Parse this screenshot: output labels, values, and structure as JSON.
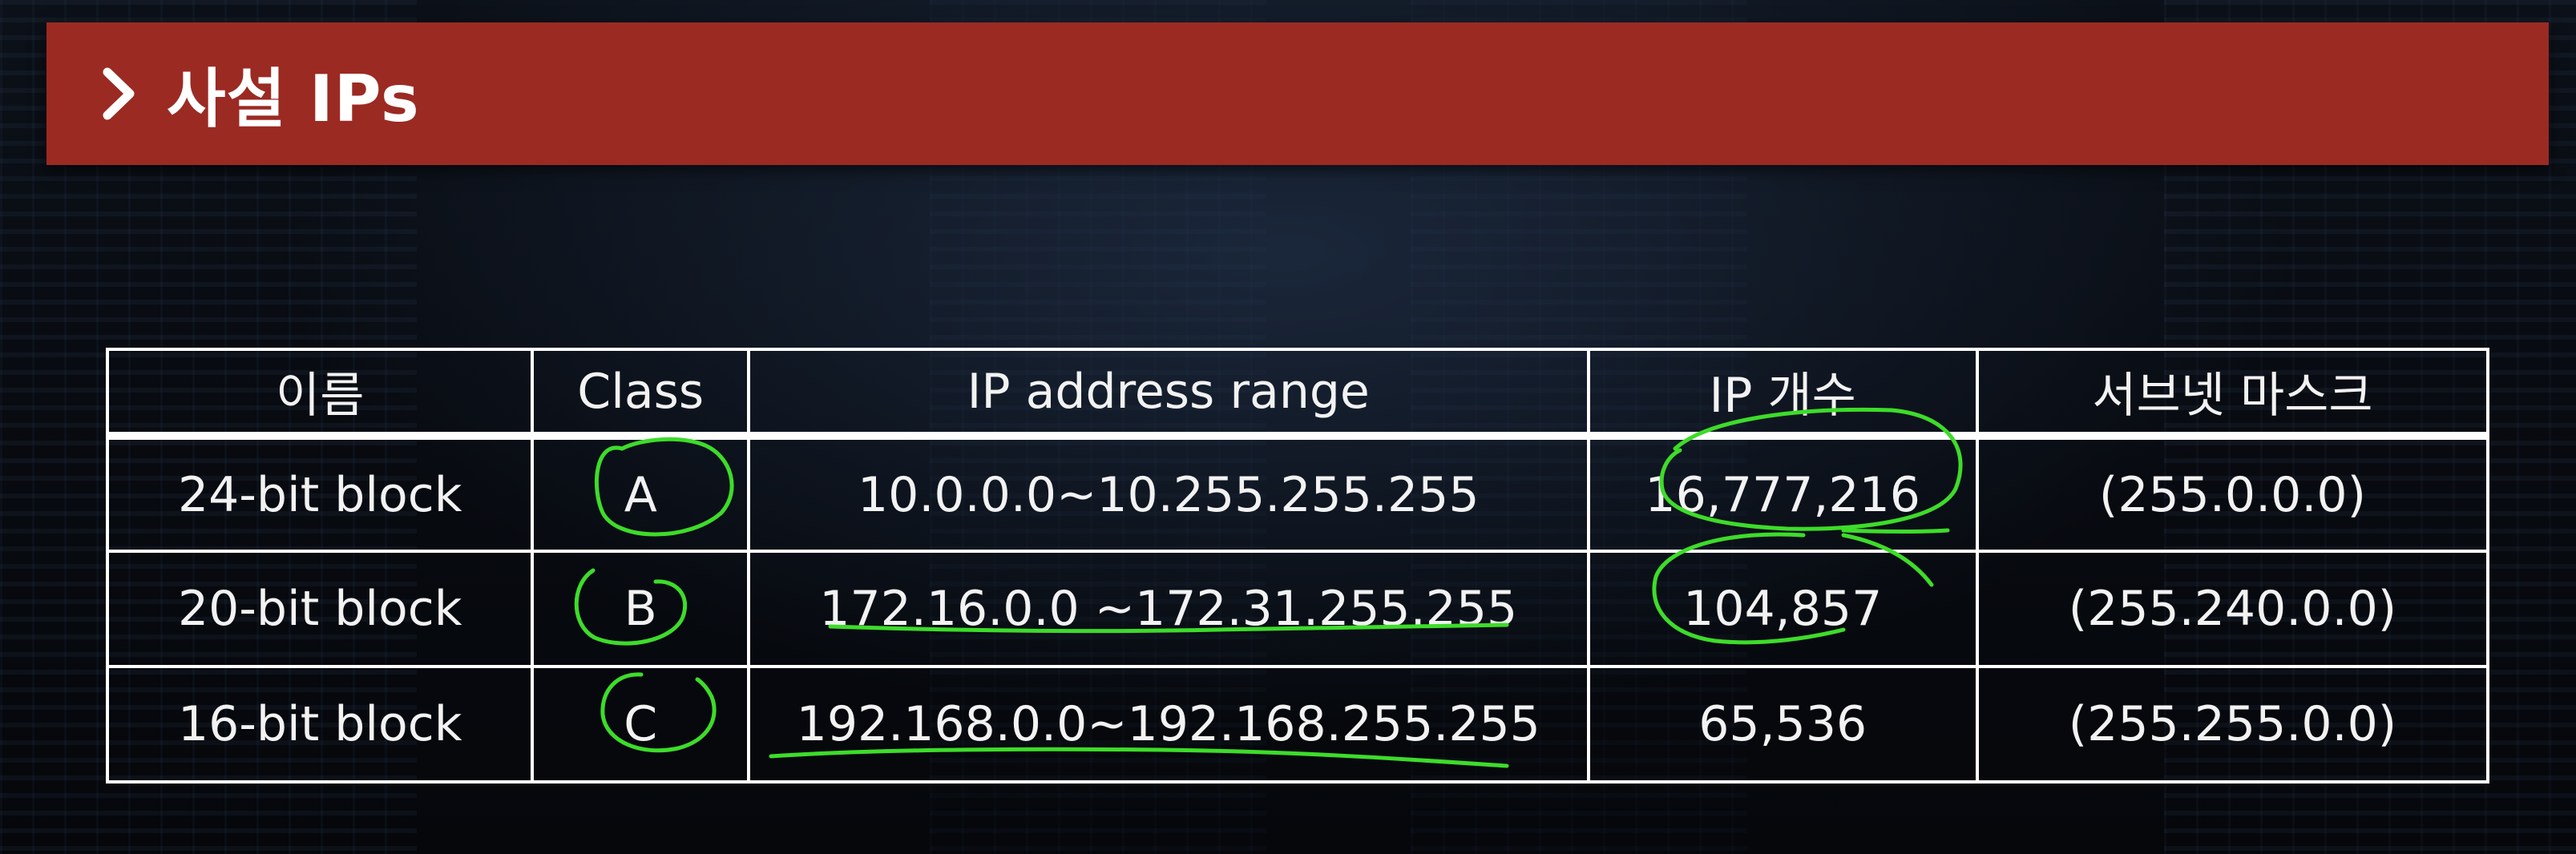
{
  "title": "사설 IPs",
  "colors": {
    "title_bar": "#9b2a23",
    "annotation": "#3ddc2a"
  },
  "icons": {
    "title": "chevron-right-icon"
  },
  "table": {
    "headers": [
      "이름",
      "Class",
      "IP address range",
      "IP 개수",
      "서브넷 마스크"
    ],
    "rows": [
      [
        "24-bit block",
        "A",
        "10.0.0.0~10.255.255.255",
        "16,777,216",
        "(255.0.0.0)"
      ],
      [
        "20-bit block",
        "B",
        "172.16.0.0 ~172.31.255.255",
        "104,857",
        "(255.240.0.0)"
      ],
      [
        "16-bit block",
        "C",
        "192.168.0.0~192.168.255.255",
        "65,536",
        "(255.255.0.0)"
      ]
    ]
  }
}
